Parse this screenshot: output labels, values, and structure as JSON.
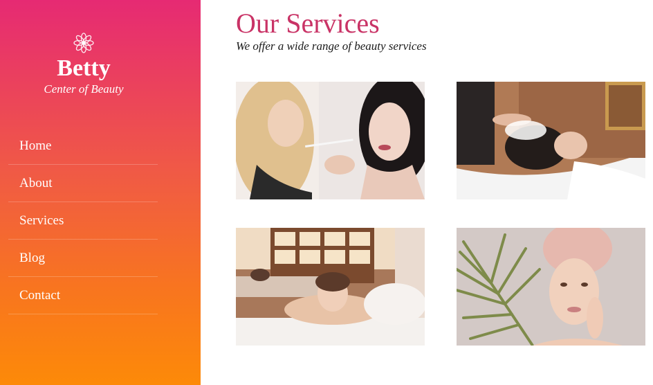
{
  "brand": {
    "name": "Betty",
    "tagline": "Center of Beauty",
    "icon": "lotus-icon"
  },
  "nav": {
    "items": [
      {
        "label": "Home"
      },
      {
        "label": "About"
      },
      {
        "label": "Services"
      },
      {
        "label": "Blog"
      },
      {
        "label": "Contact"
      }
    ]
  },
  "services": {
    "title": "Our Services",
    "subtitle": "We offer a wide range of beauty services",
    "images": [
      {
        "subject": "makeup-application-photo"
      },
      {
        "subject": "hair-washing-photo"
      },
      {
        "subject": "massage-spa-photo"
      },
      {
        "subject": "skincare-towel-photo"
      }
    ]
  },
  "colors": {
    "sidebar_top": "#e62a73",
    "sidebar_bottom": "#fd8a08",
    "title": "#c93366"
  }
}
